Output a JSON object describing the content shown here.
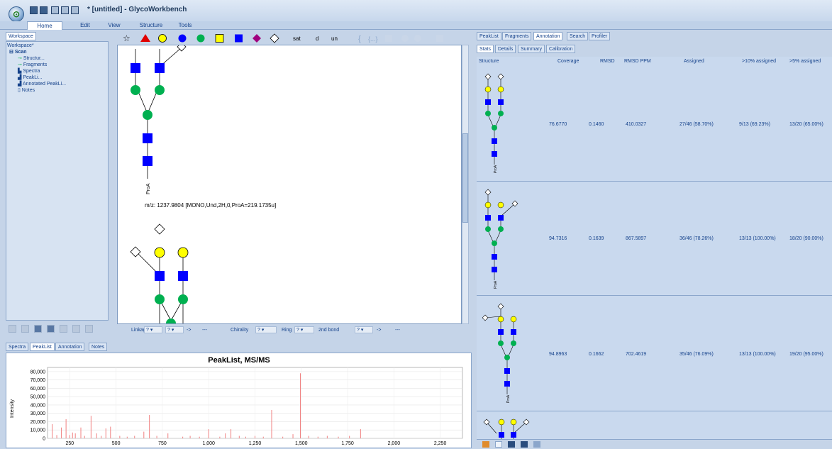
{
  "window": {
    "title": "* [untitled] - GlycoWorkbench"
  },
  "ribbon": {
    "tabs": [
      "Home",
      "Edit",
      "View",
      "Structure",
      "Tools"
    ],
    "active": "Home"
  },
  "workspace": {
    "tab_label": "Workspace",
    "tree": {
      "root": "Workspace*",
      "scan": "Scan",
      "items": [
        "Structur...",
        "Fragments",
        "Spectra",
        "PeakLi...",
        "Annotated PeakLi...",
        "Notes"
      ]
    }
  },
  "bottom_tabs": [
    "Spectra",
    "PeakList",
    "Annotation",
    "Notes"
  ],
  "bottom_tabs_active": "PeakList",
  "symbol_bar": {
    "text_buttons": [
      "sat",
      "d",
      "un"
    ]
  },
  "editor": {
    "mz_label": "m/z: 1237.9804 [MONO,Und,2H,0,ProA=219.1735u]",
    "root_label": "ProA"
  },
  "linkbar": {
    "linkage_label": "Linkage",
    "arrow": "->",
    "dots": "---",
    "chirality_label": "Chirality",
    "ring_label": "Ring",
    "second_bond_label": "2nd bond",
    "q": "?"
  },
  "peaklist_chart": {
    "title": "PeakList, MS/MS",
    "ylabel": "Intensity",
    "yticks": [
      "80,000",
      "70,000",
      "60,000",
      "50,000",
      "40,000",
      "30,000",
      "20,000",
      "10,000",
      "0"
    ],
    "xticks": [
      "250",
      "500",
      "750",
      "1,000",
      "1,250",
      "1,500",
      "1,750",
      "2,000",
      "2,250"
    ]
  },
  "chart_data": {
    "type": "bar",
    "title": "PeakList, MS/MS",
    "ylabel": "Intensity",
    "xlabel": "",
    "xlim": [
      130,
      2370
    ],
    "ylim": [
      0,
      85000
    ],
    "x": [
      155,
      180,
      205,
      230,
      250,
      265,
      280,
      310,
      330,
      365,
      395,
      420,
      445,
      470,
      520,
      560,
      600,
      650,
      680,
      720,
      780,
      860,
      900,
      950,
      1000,
      1060,
      1090,
      1120,
      1165,
      1200,
      1250,
      1295,
      1340,
      1400,
      1455,
      1495,
      1540,
      1590,
      1640,
      1700,
      1760,
      1820
    ],
    "values": [
      17000,
      4000,
      13000,
      23000,
      4000,
      7000,
      6000,
      13000,
      3000,
      27000,
      6000,
      3000,
      12000,
      14000,
      3000,
      2000,
      3000,
      8000,
      28000,
      3000,
      6000,
      2000,
      3000,
      2000,
      11000,
      2000,
      6000,
      11000,
      3000,
      2000,
      3000,
      2000,
      34000,
      2000,
      5000,
      78000,
      3000,
      2000,
      3000,
      2000,
      3000,
      11000
    ]
  },
  "annotation_panel": {
    "tabs": [
      "PeakList",
      "Fragments",
      "Annotation",
      "Search",
      "Profiler"
    ],
    "active": "Annotation",
    "subtabs": [
      "Stats",
      "Details",
      "Summary",
      "Calibration"
    ],
    "subtab_active": "Stats",
    "columns": [
      "Structure",
      "Coverage",
      "RMSD",
      "RMSD PPM",
      "Assigned",
      ">10% assigned",
      ">5% assigned"
    ],
    "rows": [
      {
        "coverage": "76.6770",
        "rmsd": "0.1460",
        "rmsd_ppm": "410.0327",
        "assigned": "27/46 (58.70%)",
        "gt10": "9/13 (69.23%)",
        "gt5": "13/20 (65.00%)"
      },
      {
        "coverage": "94.7316",
        "rmsd": "0.1639",
        "rmsd_ppm": "867.5897",
        "assigned": "36/46 (78.26%)",
        "gt10": "13/13 (100.00%)",
        "gt5": "18/20 (90.00%)"
      },
      {
        "coverage": "94.8963",
        "rmsd": "0.1662",
        "rmsd_ppm": "702.4619",
        "assigned": "35/46 (76.09%)",
        "gt10": "13/13 (100.00%)",
        "gt5": "19/20 (95.00%)"
      }
    ],
    "root_label": "ProA"
  },
  "colors": {
    "mannose": "#ffff00",
    "galactose": "#ffff00",
    "glcnac": "#0000ff",
    "glc": "#00b050",
    "fucose": "#e00000",
    "hexnac_yellow": "#ffff00",
    "neuac": "#a0007f",
    "peak": "#f08080"
  }
}
